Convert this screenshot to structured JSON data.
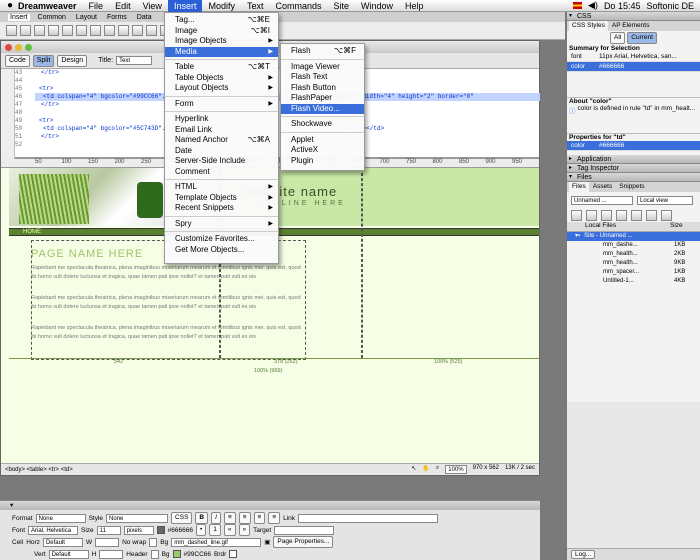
{
  "menubar": {
    "app": "Dreamweaver",
    "items": [
      "File",
      "Edit",
      "View",
      "Insert",
      "Modify",
      "Text",
      "Commands",
      "Site",
      "Window",
      "Help"
    ],
    "active": "Insert",
    "clock": "Do 15:45",
    "user": "Softonic DE"
  },
  "insertbar": {
    "tabs": [
      "Insert",
      "Common",
      "Layout",
      "Forms",
      "Data"
    ]
  },
  "doc": {
    "views": [
      "Code",
      "Split",
      "Design"
    ],
    "title_label": "Title:",
    "title_value": "Text",
    "line_numbers": [
      "43",
      "44",
      "45",
      "46",
      "47",
      "48",
      "49",
      "50",
      "51",
      "52"
    ],
    "code_lines": [
      "</tr>",
      "",
      "<tr>",
      "<td colspan=\"4\" bgcolor=\"#99CC66\"...",
      "</tr>",
      "",
      "<tr>",
      "<td colspan=\"4\" bgcolor=\"#5C743D\"...",
      "</tr>",
      ""
    ],
    "code_right": "alt=\"line decor\" width=\"4\" height=\"2\" border=\"0\"",
    "code_right2": "=\"0\" /></td>",
    "ruler_ticks": [
      "50",
      "100",
      "150",
      "200",
      "250",
      "300",
      "350",
      "400",
      "450",
      "500",
      "550",
      "600",
      "650",
      "700",
      "750",
      "800",
      "850",
      "900",
      "950"
    ],
    "site_name": "website name",
    "tagline": "TAGLINE HERE",
    "home": "HOME",
    "page_name": "PAGE NAME HERE",
    "paragraph": "Rapiebant me spectacula theatrica, plena imaginibus miseriarum mearum et fomitibus ignis mei. quis est, quod ibi homo vult dolere luctuosa et tragica, quae tamen pati ipse nollet? et tamen pati vult ex eis",
    "width_labels": [
      "542",
      "378 (262)",
      "100% (525)"
    ],
    "width_total": "100% (969)",
    "status_tags": "<body> <table> <tr> <td>",
    "zoom": "100%",
    "size": "970 x 562",
    "download": "13K / 2 sec"
  },
  "insert_menu": [
    {
      "label": "Tag...",
      "shortcut": "⌥⌘E"
    },
    {
      "label": "Image",
      "shortcut": "⌥⌘I"
    },
    {
      "label": "Image Objects",
      "arrow": true
    },
    {
      "label": "Media",
      "arrow": true,
      "selected": true
    },
    {
      "sep": true
    },
    {
      "label": "Table",
      "shortcut": "⌥⌘T"
    },
    {
      "label": "Table Objects",
      "arrow": true
    },
    {
      "label": "Layout Objects",
      "arrow": true
    },
    {
      "sep": true
    },
    {
      "label": "Form",
      "arrow": true
    },
    {
      "sep": true
    },
    {
      "label": "Hyperlink"
    },
    {
      "label": "Email Link"
    },
    {
      "label": "Named Anchor",
      "shortcut": "⌥⌘A"
    },
    {
      "label": "Date"
    },
    {
      "label": "Server-Side Include"
    },
    {
      "label": "Comment"
    },
    {
      "sep": true
    },
    {
      "label": "HTML",
      "arrow": true
    },
    {
      "label": "Template Objects",
      "arrow": true
    },
    {
      "label": "Recent Snippets",
      "arrow": true
    },
    {
      "sep": true
    },
    {
      "label": "Spry",
      "arrow": true
    },
    {
      "sep": true
    },
    {
      "label": "Customize Favorites..."
    },
    {
      "label": "Get More Objects..."
    }
  ],
  "media_menu": [
    {
      "label": "Flash",
      "shortcut": "⌥⌘F"
    },
    {
      "sep": true
    },
    {
      "label": "Image Viewer"
    },
    {
      "label": "Flash Text"
    },
    {
      "label": "Flash Button"
    },
    {
      "label": "FlashPaper"
    },
    {
      "label": "Flash Video...",
      "selected": true
    },
    {
      "sep": true
    },
    {
      "label": "Shockwave"
    },
    {
      "sep": true
    },
    {
      "label": "Applet"
    },
    {
      "label": "ActiveX"
    },
    {
      "label": "Plugin"
    }
  ],
  "panels": {
    "css": "CSS",
    "css_tabs": [
      "CSS Styles",
      "AP Elements"
    ],
    "all": "All",
    "current": "Current",
    "summary_title": "Summary for Selection",
    "summary": [
      {
        "k": "font",
        "v": "11px Arial, Helvetica, san..."
      },
      {
        "k": "color",
        "v": "#666666"
      }
    ],
    "about_title": "About \"color\"",
    "about_text": "color is defined in rule \"td\" in mm_healt...",
    "props_title": "Properties for \"td\"",
    "props_row": {
      "k": "color",
      "v": "#666666"
    },
    "application": "Application",
    "tag_inspector": "Tag Inspector",
    "files": "Files",
    "files_tabs": [
      "Files",
      "Assets",
      "Snippets"
    ],
    "site_select": "Unnamed ...",
    "view_select": "Local view",
    "col_local": "Local Files",
    "col_size": "Size",
    "site_root": "Site - Unnamed ...",
    "file_list": [
      {
        "n": "mm_dashe...",
        "s": "1KB"
      },
      {
        "n": "mm_health...",
        "s": "2KB"
      },
      {
        "n": "mm_health...",
        "s": "9KB"
      },
      {
        "n": "mm_spacer...",
        "s": "1KB"
      },
      {
        "n": "Untitled-1...",
        "s": "4KB"
      }
    ],
    "log": "Log..."
  },
  "properties": {
    "format_label": "Format",
    "format_value": "None",
    "style_label": "Style",
    "style_value": "None",
    "css_btn": "CSS",
    "link_label": "Link",
    "font_label": "Font",
    "font_value": "Arial, Helvetica",
    "size_label": "Size",
    "size_value": "11",
    "size_unit": "pixels",
    "color_value": "#666666",
    "target_label": "Target",
    "cell_label": "Cell",
    "horz_label": "Horz",
    "horz_value": "Default",
    "w_label": "W",
    "nowrap_label": "No wrap",
    "bg_label": "Bg",
    "bg_image": "mm_dashed_line.gif",
    "page_props": "Page Properties...",
    "vert_label": "Vert",
    "vert_value": "Default",
    "h_label": "H",
    "header_label": "Header",
    "bg2_label": "Bg",
    "bg_color": "#99CC66",
    "brdr_label": "Brdr"
  },
  "colors": {
    "accent": "#3a6edb",
    "banner": "#c9e8a5",
    "homebar": "#5b8030",
    "bg": "#f6ffe5",
    "swatch1": "#666666",
    "swatch2": "#99CC66"
  }
}
